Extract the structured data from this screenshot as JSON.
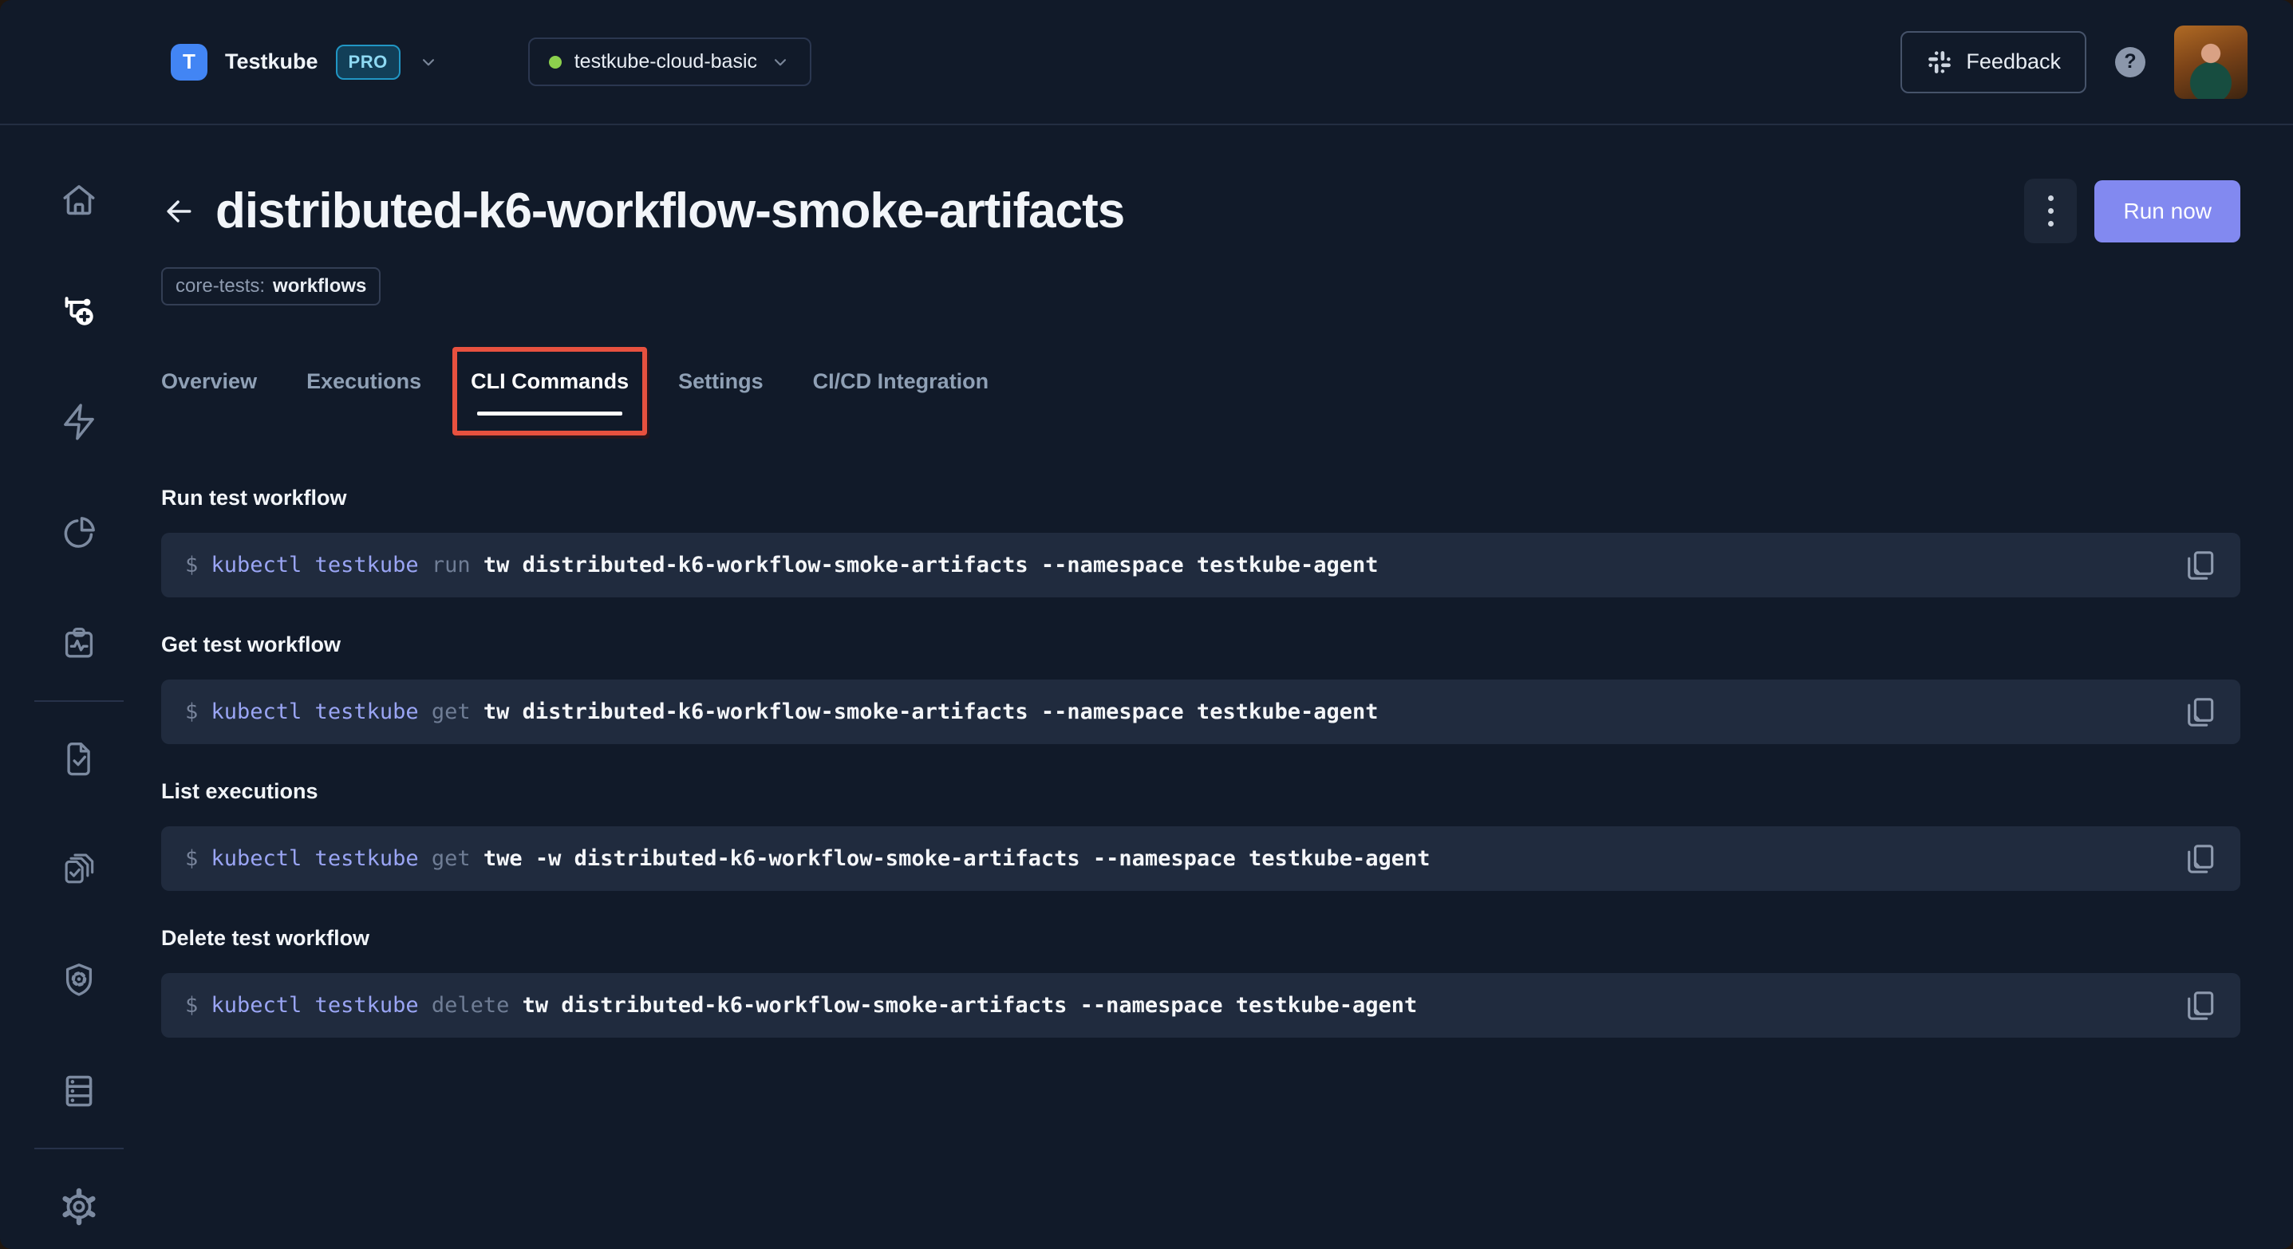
{
  "colors": {
    "page_bg": "#111A29",
    "code_bg": "#202B3E",
    "accent_run_button": "#8289F0",
    "annotation_red": "#E8513F",
    "command_highlight": "#9AA5F4",
    "env_status_green": "#8CD04D",
    "org_badge_blue": "#4285F4",
    "pro_badge_text": "#8ED9F2"
  },
  "topbar": {
    "logo_icon": "testkube-logo-icon",
    "org": {
      "initial": "T",
      "name": "Testkube",
      "plan": "PRO"
    },
    "environment": {
      "name": "testkube-cloud-basic"
    },
    "feedback_label": "Feedback",
    "help_label": "?"
  },
  "sidebar": {
    "items": [
      {
        "name": "sidebar-item-dashboard",
        "icon": "home-icon",
        "active": false
      },
      {
        "name": "sidebar-item-test-workflows",
        "icon": "test-workflows-icon",
        "active": true
      },
      {
        "name": "sidebar-item-triggers",
        "icon": "lightning-icon",
        "active": false
      },
      {
        "name": "sidebar-item-insights",
        "icon": "pie-chart-icon",
        "active": false
      },
      {
        "name": "sidebar-item-monitoring",
        "icon": "clipboard-pulse-icon",
        "active": false
      },
      {
        "type": "divider"
      },
      {
        "name": "sidebar-item-tests",
        "icon": "doc-check-icon",
        "active": false
      },
      {
        "name": "sidebar-item-test-suites",
        "icon": "docs-stack-check-icon",
        "active": false
      },
      {
        "name": "sidebar-item-webhooks",
        "icon": "shield-gear-icon",
        "active": false
      },
      {
        "name": "sidebar-item-sources",
        "icon": "server-rack-icon",
        "active": false
      },
      {
        "type": "divider"
      },
      {
        "name": "sidebar-item-settings",
        "icon": "gear-icon",
        "active": false,
        "bottom": true
      }
    ]
  },
  "page": {
    "back_icon": "arrow-left-icon",
    "title": "distributed-k6-workflow-smoke-artifacts",
    "label_chip": {
      "key": "core-tests:",
      "value": "workflows"
    },
    "menu_icon": "kebab-menu-icon",
    "run_button_label": "Run now"
  },
  "tabs": {
    "items": [
      {
        "label": "Overview",
        "active": false
      },
      {
        "label": "Executions",
        "active": false
      },
      {
        "label": "CLI Commands",
        "active": true,
        "annotated": true
      },
      {
        "label": "Settings",
        "active": false
      },
      {
        "label": "CI/CD Integration",
        "active": false
      }
    ]
  },
  "sections": [
    {
      "heading": "Run test workflow",
      "command": {
        "prompt": "$",
        "base": "kubectl testkube",
        "verb": "run",
        "args": "tw distributed-k6-workflow-smoke-artifacts --namespace testkube-agent"
      }
    },
    {
      "heading": "Get test workflow",
      "command": {
        "prompt": "$",
        "base": "kubectl testkube",
        "verb": "get",
        "args": "tw distributed-k6-workflow-smoke-artifacts --namespace testkube-agent"
      }
    },
    {
      "heading": "List executions",
      "command": {
        "prompt": "$",
        "base": "kubectl testkube",
        "verb": "get",
        "args": "twe -w distributed-k6-workflow-smoke-artifacts --namespace testkube-agent"
      }
    },
    {
      "heading": "Delete test workflow",
      "command": {
        "prompt": "$",
        "base": "kubectl testkube",
        "verb": "delete",
        "args": "tw distributed-k6-workflow-smoke-artifacts --namespace testkube-agent"
      }
    }
  ]
}
